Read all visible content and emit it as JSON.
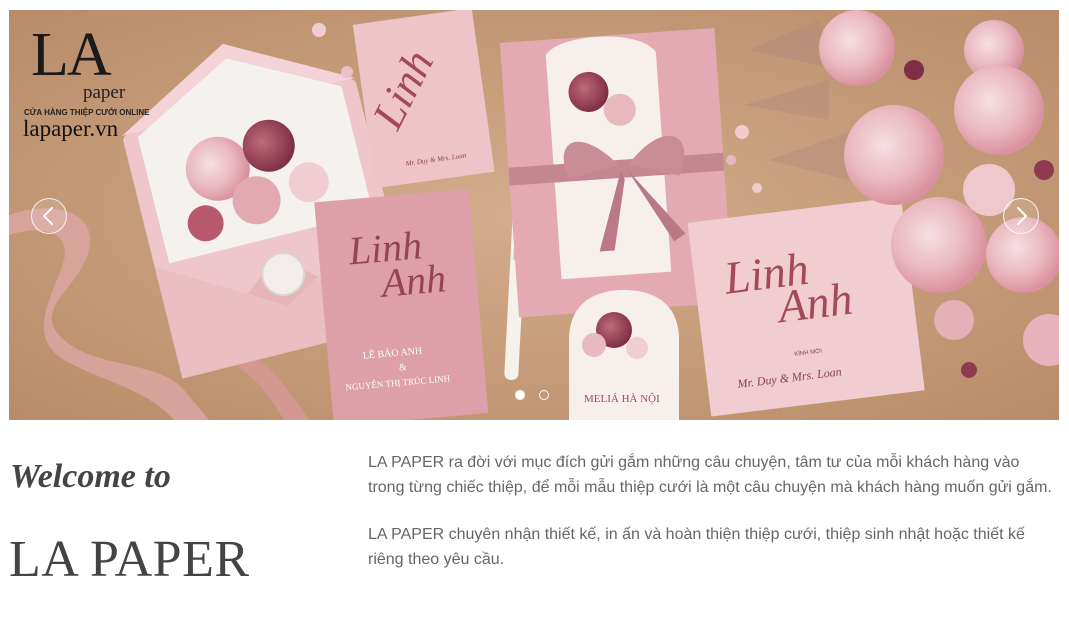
{
  "slider": {
    "logo": {
      "mark": "LA",
      "sub": "paper",
      "tagline": "CỬA HÀNG THIỆP CƯỚI ONLINE",
      "domain": "lapaper.vn"
    },
    "card_script_1": "Linh",
    "card_script_2": "Anh",
    "card_names": "Mr. Duy & Mrs. Loan",
    "card_invite": "KÍNH MỜI",
    "invite_groom": "LÊ BẢO ANH",
    "invite_amp": "&",
    "invite_bride": "NGUYỄN THỊ TRÚC LINH",
    "arch_venue": "MELIÁ HÀ NỘI",
    "active_slide": 1,
    "total_slides": 2
  },
  "welcome": {
    "heading": "Welcome to",
    "brand": "LA PAPER",
    "paragraphs": [
      "LA PAPER ra đời với mục đích gửi gắm những câu chuyện, tâm tư của mỗi khách hàng vào trong từng chiếc thiệp, để mỗi mẫu thiệp cưới là một câu chuyện mà khách hàng muốn gửi gắm.",
      "LA PAPER chuyên nhận thiết kế, in ấn và hoàn thiện thiệp cưới, thiệp sinh nhật hoặc thiết kế riêng theo yêu cầu."
    ]
  },
  "colors": {
    "text_dark": "#444444",
    "text_body": "#666666",
    "card_pink": "#e8b9bf",
    "card_deep": "#d996a0",
    "script_color": "#a3495a",
    "kraft": "#c9a07f"
  },
  "icons": {
    "prev": "chevron-left-icon",
    "next": "chevron-right-icon"
  }
}
